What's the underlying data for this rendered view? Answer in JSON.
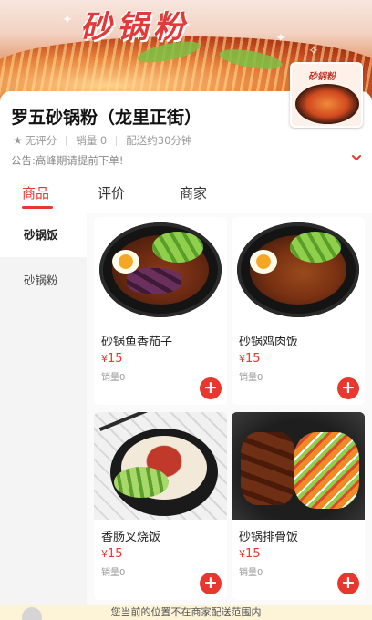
{
  "banner": {
    "title_art": "砂锅粉",
    "logo_text": "砂锅粉"
  },
  "store": {
    "name": "罗五砂锅粉（龙里正街）",
    "rating": "无评分",
    "sales": "销量 0",
    "delivery": "配送约30分钟",
    "notice": "公告:高峰期请提前下单!"
  },
  "tabs": [
    {
      "label": "商品",
      "active": true
    },
    {
      "label": "评价",
      "active": false
    },
    {
      "label": "商家",
      "active": false
    }
  ],
  "categories": [
    {
      "label": "砂锅饭",
      "active": true
    },
    {
      "label": "砂锅粉",
      "active": false
    }
  ],
  "products": [
    {
      "name": "砂锅鱼香茄子",
      "currency": "¥",
      "price": "15",
      "sales": "销量0"
    },
    {
      "name": "砂锅鸡肉饭",
      "currency": "¥",
      "price": "15",
      "sales": "销量0"
    },
    {
      "name": "香肠叉烧饭",
      "currency": "¥",
      "price": "15",
      "sales": "销量0"
    },
    {
      "name": "砂锅排骨饭",
      "currency": "¥",
      "price": "15",
      "sales": "销量0"
    }
  ],
  "add_button_label": "+",
  "bottom_notice": "您当前的位置不在商家配送范围内",
  "colors": {
    "accent": "#e8372f",
    "muted_text": "#9a9a9a",
    "sidebar_bg": "#f4f4f4",
    "notice_bg": "#fdf3d6"
  }
}
